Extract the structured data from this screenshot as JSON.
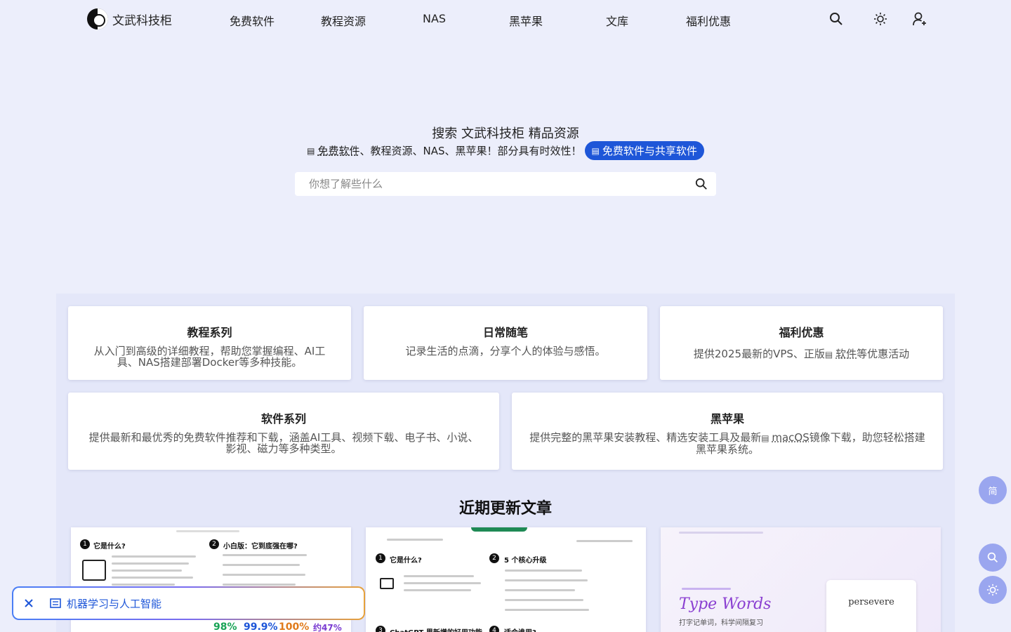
{
  "brand": {
    "name": "文武科技柜"
  },
  "nav": {
    "items": [
      "免费软件",
      "教程资源",
      "NAS",
      "黑苹果",
      "文库",
      "福利优惠"
    ]
  },
  "hero": {
    "title": "搜索 文武科技柜 精品资源",
    "subtitle_link": "免费软件",
    "subtitle_rest": "、教程资源、NAS、黑苹果！部分具有时效性！",
    "pill": "免费软件与共享软件",
    "search_placeholder": "你想了解些什么"
  },
  "cards": [
    {
      "title": "教程系列",
      "desc": "从入门到高级的详细教程，帮助您掌握编程、AI工具、NAS搭建部署Docker等多种技能。"
    },
    {
      "title": "日常随笔",
      "desc": "记录生活的点滴，分享个人的体验与感悟。"
    },
    {
      "title": "福利优惠",
      "desc_before": "提供2025最新的VPS、正版",
      "desc_link": "软件",
      "desc_after": "等优惠活动"
    },
    {
      "title": "软件系列",
      "desc": "提供最新和最优秀的免费软件推荐和下载，涵盖AI工具、视频下载、电子书、小说、影视、磁力等多种类型。"
    },
    {
      "title": "黑苹果",
      "desc_before": "提供完整的黑苹果安装教程、精选安装工具及最新",
      "desc_link": "macOS",
      "desc_after": "镜像下载，助您轻松搭建黑苹果系统。"
    }
  ],
  "recent": {
    "title": "近期更新文章",
    "thumbs": [
      {
        "h1": "它是什么?",
        "h2": "小白版：它到底强在哪?",
        "p1": "98%",
        "p2": "99.9%",
        "p3": "100%",
        "p4": "约47%"
      },
      {
        "h1": "它是什么?",
        "h2": "5 个核心升级",
        "h3": "ChatGPT 里新增的好用功能",
        "h4": "适合谁用?"
      },
      {
        "title": "Type Words",
        "sub": "打字记单词，科学间隔复习",
        "word": "persevere"
      }
    ]
  },
  "floating": {
    "lang": "简"
  },
  "toast": {
    "tag": "机器学习与人工智能"
  },
  "colors": {
    "accent": "#1e56d8",
    "fab": "#9aa6ef",
    "bg": "#eceefb"
  }
}
